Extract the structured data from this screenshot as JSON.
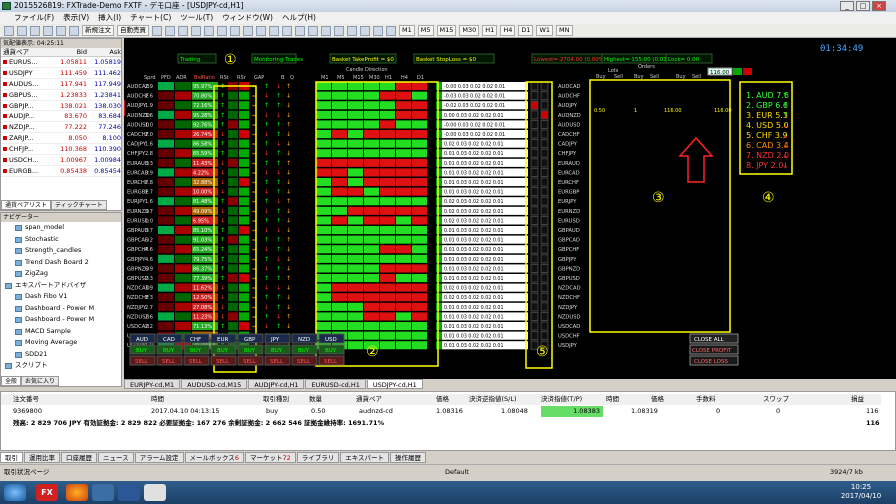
{
  "window": {
    "title": "2015526819: FXTrade-Demo FXTF - デモ口座 - [USDJPY-cd,H1]"
  },
  "menu": [
    "ファイル(F)",
    "表示(V)",
    "挿入(I)",
    "チャート(C)",
    "ツール(T)",
    "ウィンドウ(W)",
    "ヘルプ(H)"
  ],
  "toolbar": {
    "new_order": "新規注文",
    "auto_trade": "自動売買",
    "timeframes": [
      "M1",
      "M5",
      "M15",
      "M30",
      "H1",
      "H4",
      "D1",
      "W1",
      "MN"
    ]
  },
  "marketwatch": {
    "header": "気配値表示: 04:25:11",
    "col_symbol": "通貨ペア",
    "col_bid": "Bid",
    "col_ask": "Ask",
    "rows": [
      [
        "EURUS...",
        "1.05811",
        "1.05819"
      ],
      [
        "USDJPY",
        "111.459",
        "111.462"
      ],
      [
        "AUDUS...",
        "117.941",
        "117.949"
      ],
      [
        "GBPUS...",
        "1.23833",
        "1.23841"
      ],
      [
        "GBPJP...",
        "138.021",
        "138.030"
      ],
      [
        "AUDJP...",
        "83.670",
        "83.684"
      ],
      [
        "NZDJP...",
        "77.222",
        "77.246"
      ],
      [
        "ZARJP...",
        "8.050",
        "8.100"
      ],
      [
        "CHFJP...",
        "110.368",
        "110.390"
      ],
      [
        "USDCH...",
        "1.00967",
        "1.00984"
      ],
      [
        "EURGB...",
        "0.85438",
        "0.85454"
      ]
    ],
    "tabs": [
      "通貨ペアリスト",
      "ティックチャート"
    ]
  },
  "navigator": {
    "header": "ナビゲーター",
    "items": [
      "span_model",
      "Stochastic",
      "Strength_candles",
      "Trend Dash Board 2",
      "ZigZag",
      "エキスパートアドバイザ",
      "Dash Fibo V1",
      "Dashboard - Power M",
      "Dashboard - Power M",
      "MACD Sample",
      "Moving Average",
      "SDD21",
      "スクリプト"
    ],
    "tabs": [
      "全般",
      "お気に入り"
    ]
  },
  "dashboard": {
    "clock": "01:34:49",
    "topbar": [
      "Trading",
      "Monitoring Trades",
      "Basket TakeProfit = $0",
      "Basket StopLoss = $0",
      "Lowest=-2704.00 (0.00%)",
      "Highest= 155.00 (0.01%)",
      "Lock= 0.00"
    ],
    "lots_value": "116.00",
    "col_heads": [
      "Sprd",
      "PFD",
      "ADR",
      "BidRatio",
      "RSt",
      "RSr",
      "GAP",
      "B",
      "Q",
      "Candle Direction",
      "M1",
      "M5",
      "M15",
      "M30",
      "H1",
      "H4",
      "D1",
      "Lots",
      "Orders",
      "Buy",
      "Sell",
      "Buy",
      "Sell",
      "Buy",
      "Sell"
    ],
    "pairs": [
      "AUDCAD",
      "AUDCHF",
      "AUDJPY",
      "AUDNZD",
      "AUDUSD",
      "CADCHF",
      "CADJPY",
      "CHFJPY",
      "EURAUD",
      "EURCAD",
      "EURCHF",
      "EURGBP",
      "EURJPY",
      "EURNZD",
      "EURUSD",
      "GBPAUD",
      "GBPCAD",
      "GBPCHF",
      "GBPJPY",
      "GBPNZD",
      "GBPUSD",
      "NZDCAD",
      "NZDCHF",
      "NZDJPY",
      "NZDUSD",
      "USDCAD",
      "USDCHF",
      "USDJPY"
    ],
    "spreads": [
      "2.9",
      "2.6",
      "1.9",
      "3.6",
      "1.0",
      "2.0",
      "1.6",
      "2.8",
      "3.3",
      "3.9",
      "2.8",
      "1.7",
      "1.6",
      "3.7",
      "1.0",
      "3.7",
      "5.2",
      "4.6",
      "4.6",
      "6.9",
      "2.3",
      "3.9",
      "3.3",
      "2.7",
      "2.6",
      "2.2",
      "1.7",
      "1.0"
    ],
    "bidratio": [
      "95.97%",
      "70.80%",
      "72.16%",
      "95.28%",
      "92.76%",
      "26.74%",
      "86.58%",
      "85.59%",
      "11.43%",
      "4.22%",
      "32.88%",
      "10.00%",
      "81.48%",
      "49.09%",
      "6.95%",
      "85.10%",
      "91.03%",
      "65.24%",
      "79.75%",
      "86.37%",
      "77.39%",
      "11.62%",
      "12.50%",
      "27.08%",
      "11.23%",
      "71.13%",
      "53.21%",
      "78.08%"
    ],
    "diffs": [
      "-0.00",
      "-0.03",
      "-0.02",
      "0.00",
      "-0.00",
      "-0.00",
      "0.02",
      "0.01",
      "0.01",
      "0.01",
      "0.01",
      "0.01",
      "0.02",
      "0.02",
      "0.02",
      "0.01",
      "0.01",
      "0.01",
      "0.01",
      "0.01",
      "0.01",
      "0.02",
      "0.02",
      "0.01",
      "0.01",
      "0.01",
      "0.01",
      "0.01"
    ],
    "strength": [
      {
        "rank": "1.",
        "cur": "AUD",
        "val": "7.6",
        "color": "#33ff33",
        "arrow": "up"
      },
      {
        "rank": "2.",
        "cur": "GBP",
        "val": "6.6",
        "color": "#33ff33",
        "arrow": "up"
      },
      {
        "rank": "3.",
        "cur": "EUR",
        "val": "5.3",
        "color": "#ffdd00",
        "arrow": "up"
      },
      {
        "rank": "4.",
        "cur": "USD",
        "val": "5.0",
        "color": "#ffdd00",
        "arrow": "down"
      },
      {
        "rank": "5.",
        "cur": "CHF",
        "val": "3.9",
        "color": "#ffdd00",
        "arrow": "down"
      },
      {
        "rank": "6.",
        "cur": "CAD",
        "val": "3.4",
        "color": "#ff8800",
        "arrow": "down"
      },
      {
        "rank": "7.",
        "cur": "NZD",
        "val": "2.0",
        "color": "#ff3333",
        "arrow": "down"
      },
      {
        "rank": "8.",
        "cur": "JPY",
        "val": "2.0",
        "color": "#ff3333",
        "arrow": "down"
      }
    ],
    "order_row": {
      "lots": "0.50",
      "orders": "1",
      "profit": "116.00",
      "total": "116.00"
    },
    "ccy_buttons": [
      "AUD",
      "CAD",
      "CHF",
      "EUR",
      "GBP",
      "JPY",
      "NZD",
      "USD"
    ],
    "buy_label": "BUY",
    "sell_label": "SELL",
    "close_all": "CLOSE ALL",
    "close_profit": "CLOSE PROFIT",
    "close_loss": "CLOSE LOSS",
    "markers": {
      "m1": "①",
      "m2": "②",
      "m3": "③",
      "m4": "④",
      "m5": "⑤"
    }
  },
  "chart_tabs": [
    "EURJPY-cd,M1",
    "AUDUSD-cd,M15",
    "AUDJPY-cd,H1",
    "EURUSD-cd,H1",
    "USDJPY-cd,H1"
  ],
  "terminal": {
    "headers": [
      "注文番号",
      "時間",
      "取引種別",
      "数量",
      "通貨ペア",
      "価格",
      "決済逆指値(S/L)",
      "決済指値(T/P)",
      "時間",
      "価格",
      "手数料",
      "スワップ",
      "損益"
    ],
    "order": [
      "9369800",
      "2017.04.10 04:13:15",
      "buy",
      "0.50",
      "audnzd-cd",
      "1.08316",
      "1.08048",
      "1.08383",
      "",
      "1.08319",
      "0",
      "0",
      "116"
    ],
    "balance": "残高: 2 829 706 JPY  有効証拠金: 2 829 822  必要証拠金: 167 276  余剰証拠金: 2 662 546  証拠金維持率: 1691.71%",
    "balance_pl": "116",
    "tabs": [
      "取引",
      "運用比率",
      "口座履歴",
      "ニュース",
      "アラーム設定",
      "メールボックス",
      "マーケット",
      "ライブラリ",
      "エキスパート",
      "操作履歴"
    ],
    "mailbox_badge": "6",
    "market_badge": "72"
  },
  "statusbar": {
    "left": "取引状況ページ",
    "mid": "Default",
    "right": "3924/7 kb"
  },
  "taskbar": {
    "time": "10:25",
    "date": "2017/04/10"
  }
}
